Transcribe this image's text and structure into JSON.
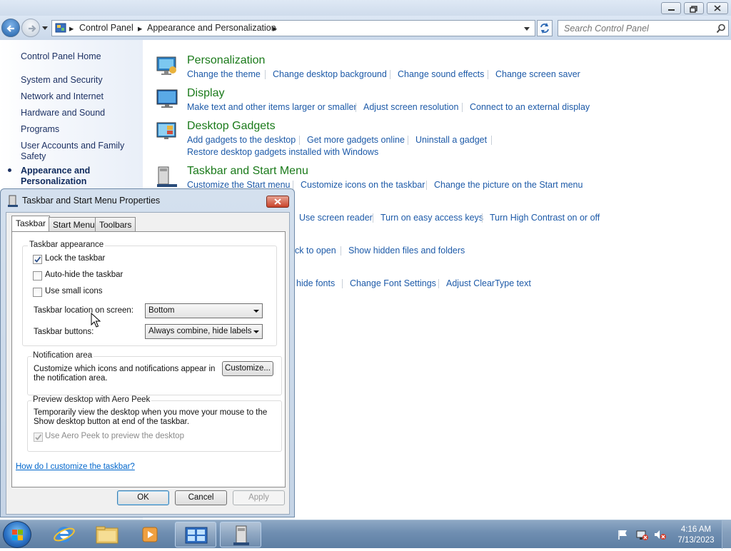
{
  "window": {
    "address": {
      "crumb1": "Control Panel",
      "crumb2": "Appearance and Personalization"
    },
    "search": {
      "placeholder": "Search Control Panel"
    }
  },
  "left_pane": {
    "home": "Control Panel Home",
    "items": [
      "System and Security",
      "Network and Internet",
      "Hardware and Sound",
      "Programs",
      "User Accounts and Family Safety"
    ],
    "active": "Appearance and Personalization"
  },
  "categories": {
    "personalization": {
      "title": "Personalization",
      "links": [
        "Change the theme",
        "Change desktop background",
        "Change sound effects",
        "Change screen saver"
      ]
    },
    "display": {
      "title": "Display",
      "links": [
        "Make text and other items larger or smaller",
        "Adjust screen resolution",
        "Connect to an external display"
      ]
    },
    "gadgets": {
      "title": "Desktop Gadgets",
      "links": [
        "Add gadgets to the desktop",
        "Get more gadgets online",
        "Uninstall a gadget",
        "Restore desktop gadgets installed with Windows"
      ]
    },
    "taskbar": {
      "title": "Taskbar and Start Menu",
      "links": [
        "Customize the Start menu",
        "Customize icons on the taskbar",
        "Change the picture on the Start menu"
      ]
    },
    "ease_links": [
      "Use screen reader",
      "Turn on easy access keys",
      "Turn High Contrast on or off"
    ],
    "folder_links": [
      "ck to open",
      "Show hidden files and folders"
    ],
    "font_links": [
      "hide fonts",
      "Change Font Settings",
      "Adjust ClearType text"
    ]
  },
  "dialog": {
    "title": "Taskbar and Start Menu Properties",
    "tabs": [
      "Taskbar",
      "Start Menu",
      "Toolbars"
    ],
    "appearance": {
      "group": "Taskbar appearance",
      "lock": {
        "label": "Lock the taskbar",
        "checked": true
      },
      "autohide": {
        "label": "Auto-hide the taskbar",
        "checked": false
      },
      "small_icons": {
        "label": "Use small icons",
        "checked": false
      },
      "location_label": "Taskbar location on screen:",
      "location_value": "Bottom",
      "buttons_label": "Taskbar buttons:",
      "buttons_value": "Always combine, hide labels"
    },
    "notification": {
      "group": "Notification area",
      "text": "Customize which icons and notifications appear in the notification area.",
      "button": "Customize..."
    },
    "peek": {
      "group": "Preview desktop with Aero Peek",
      "text": "Temporarily view the desktop when you move your mouse to the Show desktop button at end of the taskbar.",
      "checkbox": "Use Aero Peek to preview the desktop"
    },
    "help_link": "How do I customize the taskbar?",
    "buttons": {
      "ok": "OK",
      "cancel": "Cancel",
      "apply": "Apply"
    }
  },
  "taskbar": {
    "time": "4:16 AM",
    "date": "7/13/2023"
  },
  "colors": {
    "link": "#1d5aa8",
    "heading": "#1a7a1a",
    "nav_text": "#1e3264"
  }
}
